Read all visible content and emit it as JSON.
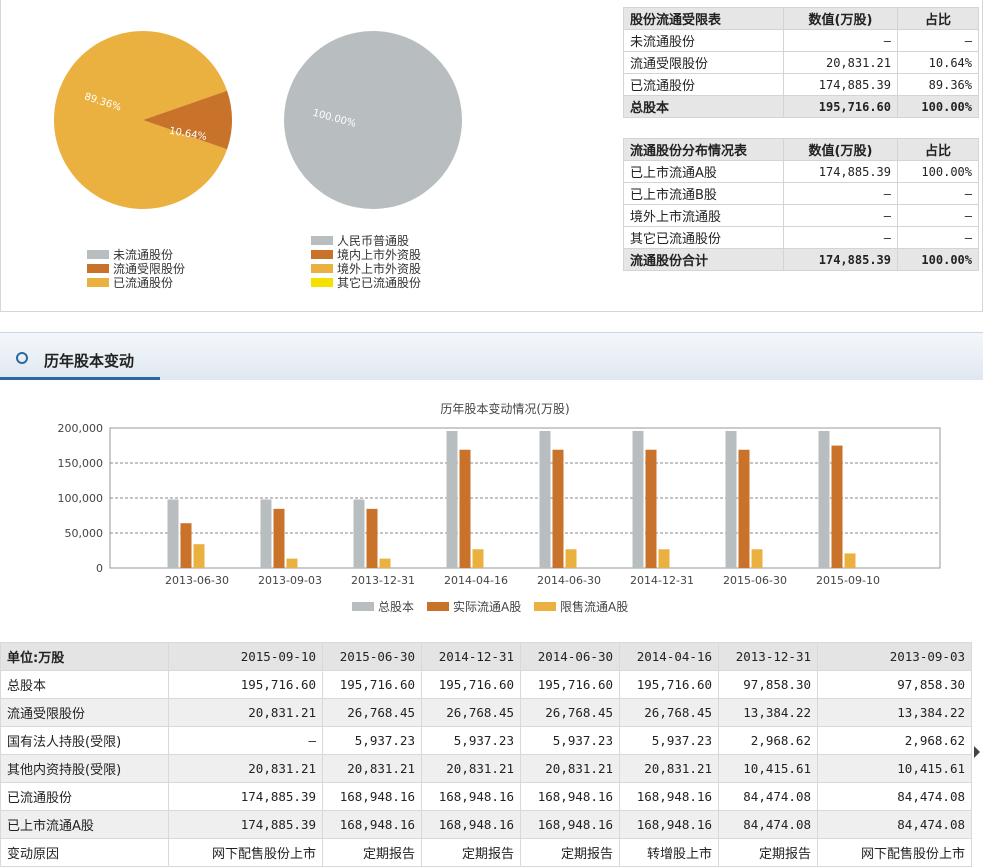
{
  "pie_left": {
    "labels": [
      "89.36%",
      "10.64%"
    ],
    "legend": [
      "未流通股份",
      "流通受限股份",
      "已流通股份"
    ],
    "colors": [
      "#b8bec0",
      "#c8722a",
      "#eab040"
    ],
    "values": [
      0,
      10.64,
      89.36
    ]
  },
  "pie_right": {
    "labels": [
      "100.00%"
    ],
    "legend": [
      "人民币普通股",
      "境内上市外资股",
      "境外上市外资股",
      "其它已流通股份"
    ],
    "colors": [
      "#b8bec0",
      "#c8722a",
      "#eab040",
      "#f6e000"
    ],
    "values": [
      100,
      0,
      0,
      0
    ]
  },
  "table_restricted": {
    "headers": [
      "股份流通受限表",
      "数值(万股)",
      "占比"
    ],
    "rows": [
      [
        "未流通股份",
        "—",
        "—"
      ],
      [
        "流通受限股份",
        "20,831.21",
        "10.64%"
      ],
      [
        "已流通股份",
        "174,885.39",
        "89.36%"
      ]
    ],
    "total": [
      "总股本",
      "195,716.60",
      "100.00%"
    ]
  },
  "table_distribution": {
    "headers": [
      "流通股份分布情况表",
      "数值(万股)",
      "占比"
    ],
    "rows": [
      [
        "已上市流通A股",
        "174,885.39",
        "100.00%"
      ],
      [
        "已上市流通B股",
        "—",
        "—"
      ],
      [
        "境外上市流通股",
        "—",
        "—"
      ],
      [
        "其它已流通股份",
        "—",
        "—"
      ]
    ],
    "total": [
      "流通股份合计",
      "174,885.39",
      "100.00%"
    ]
  },
  "section": {
    "title": "历年股本变动"
  },
  "chart_data": {
    "type": "bar",
    "title": "历年股本变动情况(万股)",
    "categories": [
      "2013-06-30",
      "2013-09-03",
      "2013-12-31",
      "2014-04-16",
      "2014-06-30",
      "2014-12-31",
      "2015-06-30",
      "2015-09-10"
    ],
    "series": [
      {
        "name": "总股本",
        "color": "#b8bec0",
        "values": [
          97858.3,
          97858.3,
          97858.3,
          195716.6,
          195716.6,
          195716.6,
          195716.6,
          195716.6
        ]
      },
      {
        "name": "实际流通A股",
        "color": "#c8722a",
        "values": [
          64000,
          84474.08,
          84474.08,
          168948.16,
          168948.16,
          168948.16,
          168948.16,
          174885.39
        ]
      },
      {
        "name": "限售流通A股",
        "color": "#eab040",
        "values": [
          34000,
          13384.22,
          13384.22,
          26768.45,
          26768.45,
          26768.45,
          26768.45,
          20831.21
        ]
      }
    ],
    "yticks": [
      "200,000",
      "150,000",
      "100,000",
      "50,000",
      "0"
    ],
    "ylim": [
      0,
      200000
    ],
    "grid": true,
    "legend_position": "bottom"
  },
  "grid_table": {
    "header": [
      "单位:万股",
      "2015-09-10",
      "2015-06-30",
      "2014-12-31",
      "2014-06-30",
      "2014-04-16",
      "2013-12-31",
      "2013-09-03"
    ],
    "rows": [
      [
        "总股本",
        "195,716.60",
        "195,716.60",
        "195,716.60",
        "195,716.60",
        "195,716.60",
        "97,858.30",
        "97,858.30"
      ],
      [
        "流通受限股份",
        "20,831.21",
        "26,768.45",
        "26,768.45",
        "26,768.45",
        "26,768.45",
        "13,384.22",
        "13,384.22"
      ],
      [
        "国有法人持股(受限)",
        "—",
        "5,937.23",
        "5,937.23",
        "5,937.23",
        "5,937.23",
        "2,968.62",
        "2,968.62"
      ],
      [
        "其他内资持股(受限)",
        "20,831.21",
        "20,831.21",
        "20,831.21",
        "20,831.21",
        "20,831.21",
        "10,415.61",
        "10,415.61"
      ],
      [
        "已流通股份",
        "174,885.39",
        "168,948.16",
        "168,948.16",
        "168,948.16",
        "168,948.16",
        "84,474.08",
        "84,474.08"
      ],
      [
        "已上市流通A股",
        "174,885.39",
        "168,948.16",
        "168,948.16",
        "168,948.16",
        "168,948.16",
        "84,474.08",
        "84,474.08"
      ],
      [
        "变动原因",
        "网下配售股份上市",
        "定期报告",
        "定期报告",
        "定期报告",
        "转增股上市",
        "定期报告",
        "网下配售股份上市"
      ]
    ]
  }
}
